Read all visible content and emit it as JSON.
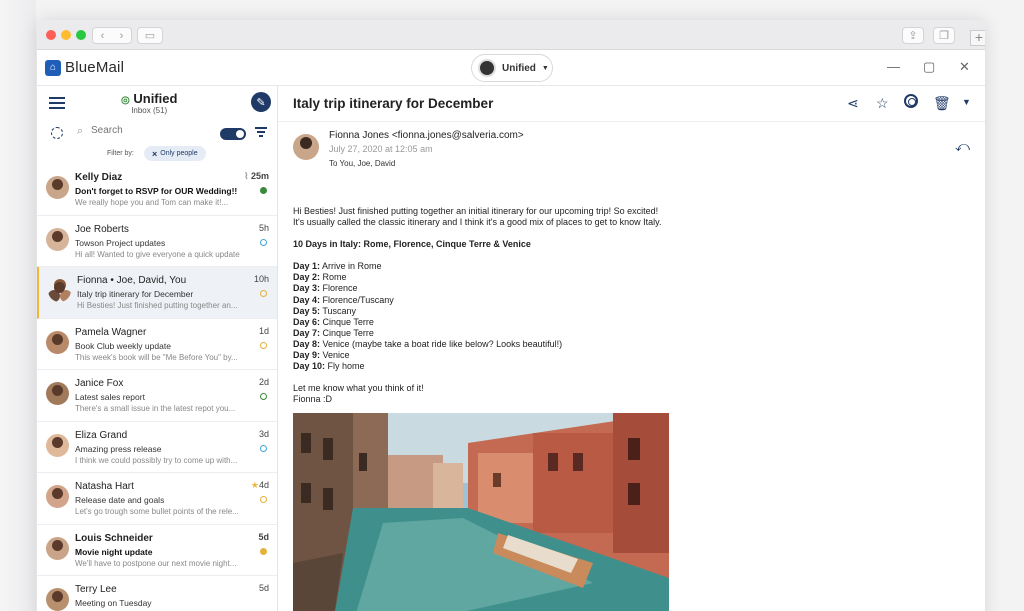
{
  "app": {
    "name": "BlueMail",
    "account_switcher": "Unified"
  },
  "sidebar": {
    "folder_title": "Unified",
    "folder_subtitle": "Inbox (51)",
    "search_placeholder": "Search",
    "filter_label": "Filter by:",
    "filter_chip": "Only people"
  },
  "mails": [
    {
      "from": "Kelly Diaz",
      "subject": "Don't forget to RSVP for OUR Wedding!!",
      "preview": "We really hope you and Tom can make it!...",
      "time": "25m",
      "unread": true,
      "marker": "green",
      "attachment": true
    },
    {
      "from": "Joe Roberts",
      "subject": "Towson Project updates",
      "preview": "Hi all! Wanted to give everyone a quick update",
      "time": "5h",
      "marker": "blue"
    },
    {
      "from": "Fionna • Joe, David, You",
      "subject": "Italy trip itinerary for December",
      "preview": "Hi Besties! Just finished putting together an...",
      "time": "10h",
      "marker": "yellow",
      "selected": true
    },
    {
      "from": "Pamela Wagner",
      "subject": "Book Club weekly update",
      "preview": "This week's book will be \"Me Before You\" by...",
      "time": "1d",
      "marker": "yellow"
    },
    {
      "from": "Janice Fox",
      "subject": "Latest sales report",
      "preview": "There's a small issue in the latest repot you...",
      "time": "2d",
      "marker": "darkgreen"
    },
    {
      "from": "Eliza Grand",
      "subject": "Amazing press release",
      "preview": "I think we could possibly try to come up with...",
      "time": "3d",
      "marker": "blue"
    },
    {
      "from": "Natasha Hart",
      "subject": "Release date and goals",
      "preview": "Let's go trough some bullet points of the rele...",
      "time": "4d",
      "marker": "yellow",
      "starred": true
    },
    {
      "from": "Louis Schneider",
      "subject": "Movie night update",
      "preview": "We'll have to postpone our next movie night...",
      "time": "5d",
      "unread": true,
      "marker": "yellow-fill"
    },
    {
      "from": "Terry Lee",
      "subject": "Meeting on Tuesday",
      "preview": "",
      "time": "5d",
      "marker": "blue"
    }
  ],
  "message": {
    "subject": "Italy trip itinerary for December",
    "sender": "Fionna Jones <fionna.jones@salveria.com>",
    "date": "July 27, 2020 at 12:05 am",
    "to": "To You, Joe, David",
    "intro1": "Hi Besties! Just finished putting together an initial itinerary for our upcoming trip! So excited!",
    "intro2": "It's usually called the classic itinerary and I think it's a good mix of places to get to know Italy.",
    "heading": "10 Days in Italy: Rome, Florence, Cinque Terre & Venice",
    "days": [
      {
        "label": "Day 1:",
        "text": "Arrive in Rome"
      },
      {
        "label": "Day 2:",
        "text": "Rome"
      },
      {
        "label": "Day 3:",
        "text": "Florence"
      },
      {
        "label": "Day 4:",
        "text": "Florence/Tuscany"
      },
      {
        "label": "Day 5:",
        "text": "Tuscany"
      },
      {
        "label": "Day 6:",
        "text": "Cinque Terre"
      },
      {
        "label": "Day 7:",
        "text": "Cinque Terre"
      },
      {
        "label": "Day 8:",
        "text": "Venice (maybe take a boat ride like below? Looks beautiful!)"
      },
      {
        "label": "Day 9:",
        "text": "Venice"
      },
      {
        "label": "Day 10:",
        "text": "Fly home"
      }
    ],
    "closing": "Let me know what you think of it!",
    "signature": "Fionna :D"
  },
  "colors": {
    "accent": "#1f3a66",
    "brand": "#1f5eb8",
    "selected_bar": "#f2b636"
  }
}
